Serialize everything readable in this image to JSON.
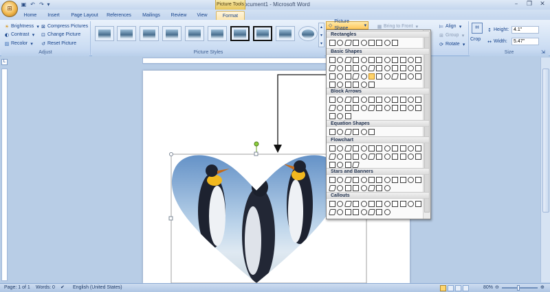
{
  "window": {
    "title": "Document1 - Microsoft Word",
    "context_title": "Picture Tools",
    "minimize": "–",
    "restore": "❐",
    "close": "✕"
  },
  "qat": {
    "save": "▣",
    "undo": "↶",
    "redo": "↷"
  },
  "tabs": [
    "Home",
    "Insert",
    "Page Layout",
    "References",
    "Mailings",
    "Review",
    "View",
    "Format"
  ],
  "adjust": {
    "brightness": "Brightness",
    "contrast": "Contrast",
    "recolor": "Recolor",
    "compress": "Compress Pictures",
    "change": "Change Picture",
    "reset": "Reset Picture",
    "group_label": "Adjust"
  },
  "styles": {
    "group_label": "Picture Styles"
  },
  "arrange": {
    "picture_shape": "Picture Shape",
    "bring_front": "Bring to Front",
    "align": "Align",
    "group": "Group",
    "rotate": "Rotate"
  },
  "size": {
    "crop": "Crop",
    "height_label": "Height:",
    "height_value": "4.1\"",
    "width_label": "Width:",
    "width_value": "5.47\"",
    "group_label": "Size"
  },
  "menu": {
    "sections": [
      {
        "title": "Rectangles",
        "count": 9
      },
      {
        "title": "Basic Shapes",
        "count": 42
      },
      {
        "title": "Block Arrows",
        "count": 27
      },
      {
        "title": "Equation Shapes",
        "count": 6
      },
      {
        "title": "Flowchart",
        "count": 28
      },
      {
        "title": "Stars and Banners",
        "count": 20
      },
      {
        "title": "Callouts",
        "count": 20
      }
    ]
  },
  "status": {
    "page": "Page: 1 of 1",
    "words": "Words: 0",
    "language": "English (United States)",
    "zoom": "80%"
  }
}
